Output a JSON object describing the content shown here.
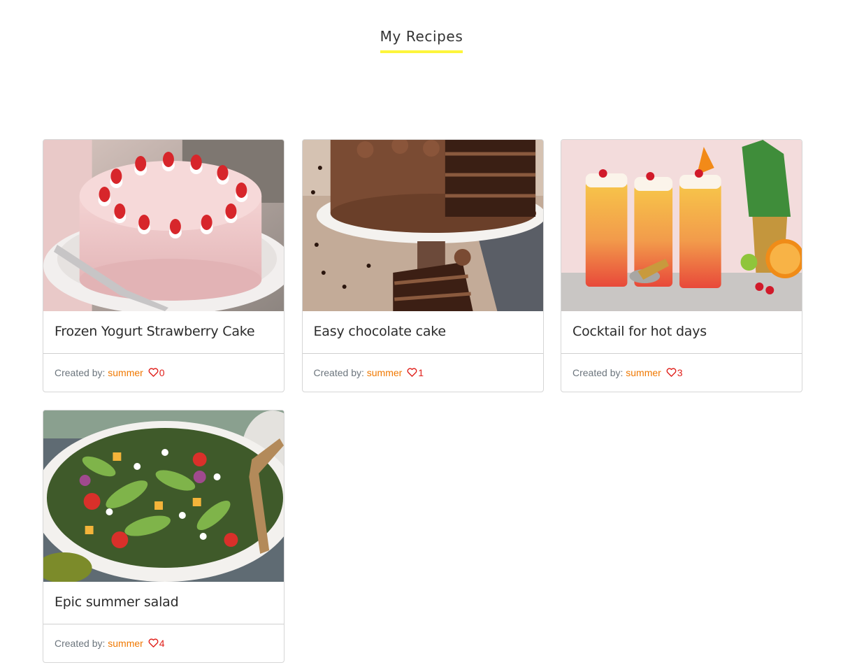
{
  "header": {
    "title": "My Recipes",
    "accent_color": "#fdf53c"
  },
  "labels": {
    "created_by": "Created by:"
  },
  "colors": {
    "author": "#f07800",
    "likes": "#e0201b"
  },
  "recipes": [
    {
      "title": "Frozen Yogurt Strawberry Cake",
      "author": "summer",
      "likes": "0",
      "image": "strawberry-cake-image"
    },
    {
      "title": "Easy chocolate cake",
      "author": "summer",
      "likes": "1",
      "image": "chocolate-cake-image"
    },
    {
      "title": "Cocktail for hot days",
      "author": "summer",
      "likes": "3",
      "image": "cocktail-image"
    },
    {
      "title": "Epic summer salad",
      "author": "summer",
      "likes": "4",
      "image": "summer-salad-image"
    }
  ]
}
